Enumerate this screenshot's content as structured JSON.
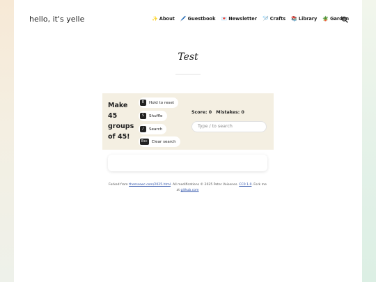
{
  "site": {
    "title": "hello, it's yelle"
  },
  "nav": {
    "items": [
      {
        "emoji": "✨",
        "label": "About"
      },
      {
        "emoji": "🖊️",
        "label": "Guestbook"
      },
      {
        "emoji": "💌",
        "label": "Newsletter"
      },
      {
        "emoji": "🪡",
        "label": "Crafts"
      },
      {
        "emoji": "📚",
        "label": "Library"
      },
      {
        "emoji": "🪴",
        "label": "Garden"
      }
    ],
    "search_icon": "search-icon"
  },
  "page": {
    "title": "Test"
  },
  "game": {
    "instruction_lines": [
      "Make",
      "45",
      "groups",
      "of 45!"
    ],
    "shortcuts": [
      {
        "key": "R",
        "label": "Hold to reset"
      },
      {
        "key": "S",
        "label": "Shuffle"
      },
      {
        "key": "/",
        "label": "Search"
      },
      {
        "key": "Esc",
        "label": "Clear search"
      }
    ],
    "score_label": "Score:",
    "score_value": "0",
    "mistakes_label": "Mistakes:",
    "mistakes_value": "0",
    "search_placeholder": "Type / to search"
  },
  "footer": {
    "text1": "Forked from ",
    "link1": "themaswc.com/2025.html",
    "text2": ". All modifications © 2025 Peter Veisenes. ",
    "link2": "CC0 1.0",
    "text3": ". Fork me at ",
    "link3": "github.com"
  },
  "colors": {
    "panel": "#f4efe2",
    "link": "#2a4fa8",
    "kbd": "#222222"
  }
}
